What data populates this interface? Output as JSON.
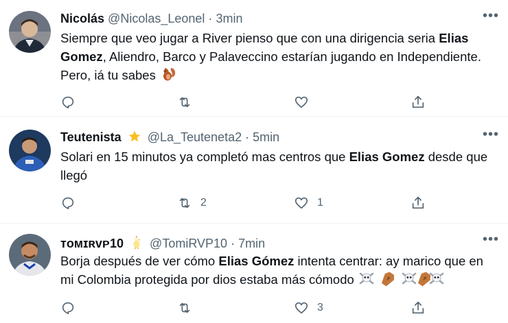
{
  "tweets": [
    {
      "name": "Nicolás",
      "handle": "@Nicolas_Leonel",
      "dot": "·",
      "time": "3min",
      "text_parts": [
        "Siempre que veo jugar a River pienso que con una dirigencia seria ",
        "Elias Gomez",
        ", Aliendro, Barco y Palaveccino estarían jugando en Independiente. Pero, iá tu sabes"
      ],
      "emoji": "squirrel-emoji",
      "reply_count": "",
      "retweet_count": "",
      "like_count": ""
    },
    {
      "name": "Teutenista",
      "badge": "star-emoji",
      "handle": "@La_Teuteneta2",
      "dot": "·",
      "time": "5min",
      "text_parts": [
        "Solari en 15 minutos ya completó mas centros que ",
        "Elias Gomez",
        " desde que llegó"
      ],
      "reply_count": "",
      "retweet_count": "2",
      "like_count": "1"
    },
    {
      "name": "ᴛᴏᴍɪʀᴠᴘ10",
      "badge": "chicken-emoji",
      "handle": "@TomiRVP10",
      "dot": "·",
      "time": "7min",
      "text_parts": [
        "Borja después de ver cómo ",
        "Elias Gómez",
        " intenta centrar: ay marico que en mi Colombia protegida por dios estaba más cómodo"
      ],
      "emoji": "skull-crossbones-coffin-emojis",
      "reply_count": "",
      "retweet_count": "",
      "like_count": "3"
    }
  ],
  "colors": {
    "text": "#0f1419",
    "secondary": "#536471",
    "divider": "#eff3f4"
  }
}
